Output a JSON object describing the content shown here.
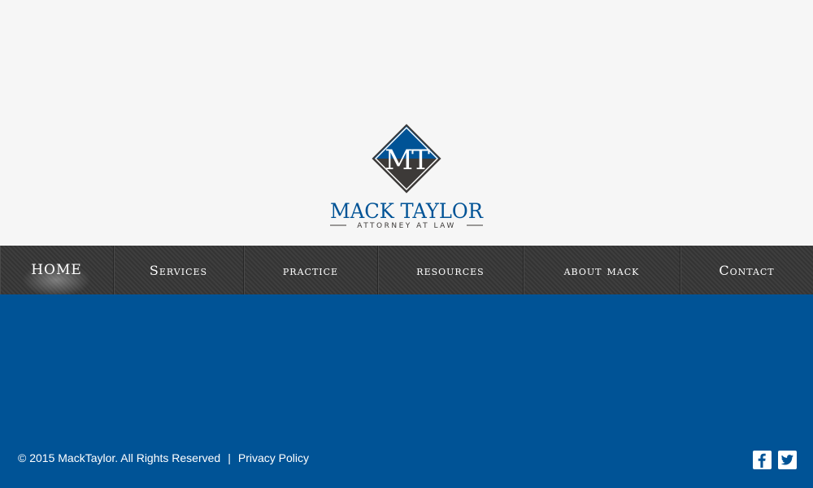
{
  "brand": {
    "monogram": "MT",
    "name": "MACK TAYLOR",
    "tagline": "ATTORNEY AT LAW"
  },
  "nav": {
    "items": [
      {
        "label": "HOME",
        "active": true
      },
      {
        "label": "Services",
        "active": false
      },
      {
        "label": "practice",
        "active": false
      },
      {
        "label": "resources",
        "active": false
      },
      {
        "label": "about mack",
        "active": false
      },
      {
        "label": "Contact",
        "active": false
      }
    ]
  },
  "footer": {
    "copyright": "© 2015 MackTaylor. All Rights Reserved",
    "separator": "|",
    "privacy_label": "Privacy Policy"
  },
  "social": {
    "icons": [
      "facebook-icon",
      "twitter-icon"
    ]
  },
  "colors": {
    "brand_blue": "#005396",
    "logo_dark": "#3d3a38",
    "nav_bg": "#3a3a3a",
    "header_bg": "#f6f6f6"
  }
}
